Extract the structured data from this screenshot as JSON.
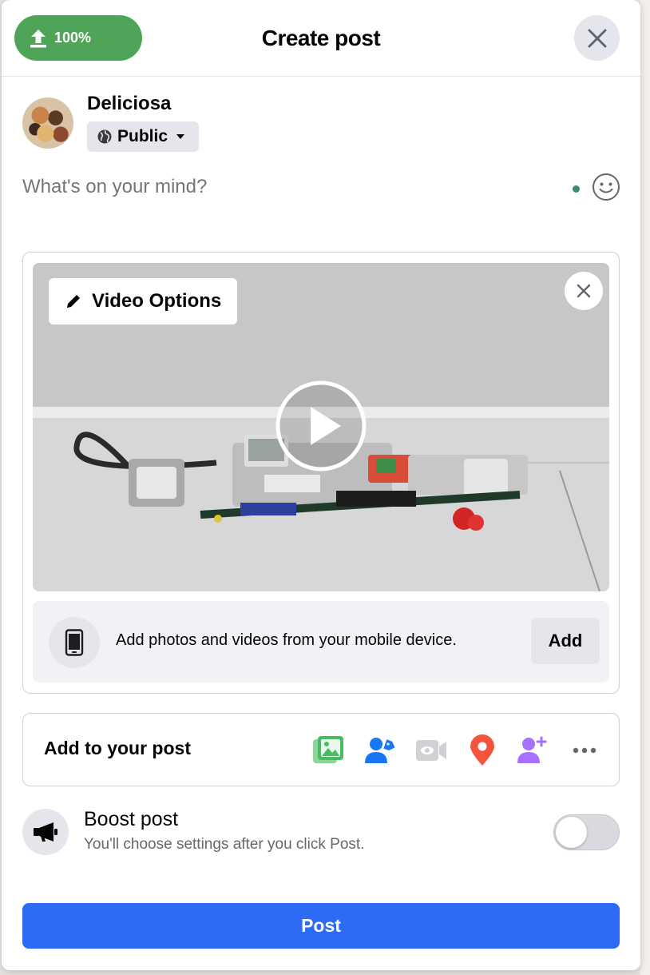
{
  "header": {
    "upload_progress": "100%",
    "title": "Create post"
  },
  "user": {
    "name": "Deliciosa",
    "audience": "Public"
  },
  "composer": {
    "placeholder": "What's on your mind?"
  },
  "media": {
    "video_options_label": "Video Options",
    "mobile_text": "Add photos and videos from your mobile device.",
    "add_label": "Add"
  },
  "add_to_post": {
    "label": "Add to your post",
    "tools": [
      "photo-video-icon",
      "tag-people-icon",
      "live-video-icon",
      "check-in-icon",
      "add-person-icon",
      "more-icon"
    ]
  },
  "boost": {
    "title": "Boost post",
    "subtitle": "You'll choose settings after you click Post.",
    "enabled": false
  },
  "post_button": "Post",
  "colors": {
    "upload_green": "#4fa457",
    "primary_blue": "#2d6bf4",
    "secondary_gray": "#e4e6eb"
  }
}
